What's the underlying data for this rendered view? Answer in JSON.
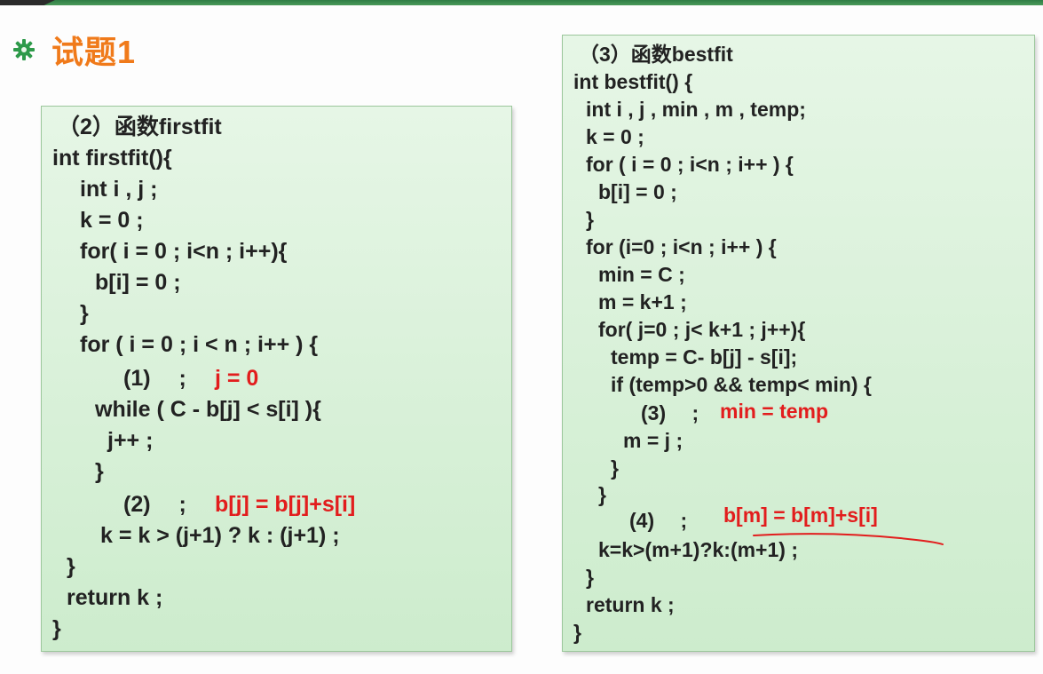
{
  "slide": {
    "title": "试题1"
  },
  "icons": {
    "bullet": "green-gear-bullet-icon"
  },
  "colors": {
    "title": "#f07a1a",
    "answer": "#e21d1d",
    "panel": "#d6f0d6"
  },
  "left_panel": {
    "lines": [
      "（2）函数firstfit",
      "int firstfit(){",
      "int i , j ;",
      "k = 0 ;",
      "for( i = 0 ; i<n ; i++){",
      "b[i] = 0 ;",
      "}",
      "for ( i = 0 ; i < n ; i++ ) {",
      "(1)　 ;",
      "j = 0",
      "while ( C - b[j] < s[i] ){",
      "j++ ;",
      "}",
      "(2)　 ;",
      "b[j] = b[j]+s[i]",
      "k = k > (j+1) ? k : (j+1) ;",
      "}",
      "return k ;",
      "}"
    ]
  },
  "right_panel": {
    "lines": [
      "（3）函数bestfit",
      "int bestfit() {",
      "int i , j , min , m , temp;",
      "k = 0 ;",
      "for ( i = 0 ; i<n ; i++ ) {",
      "b[i] = 0 ;",
      "}",
      "for (i=0 ; i<n ; i++ ) {",
      "min = C ;",
      "m = k+1 ;",
      "for( j=0 ; j< k+1 ; j++){",
      "temp = C- b[j] - s[i];",
      "if (temp>0 && temp< min) {",
      "(3)　 ;",
      "min = temp",
      "m = j ;",
      "}",
      "}",
      "(4)　 ;",
      "b[m] = b[m]+s[i]",
      "k=k>(m+1)?k:(m+1) ;",
      "}",
      "return k ;",
      "}"
    ]
  }
}
